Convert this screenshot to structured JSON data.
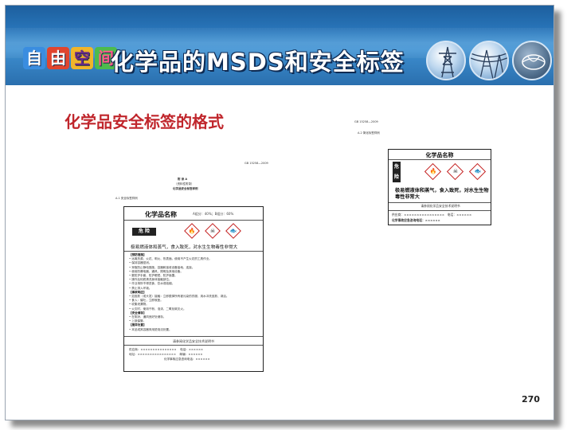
{
  "banner": {
    "logo_chars": [
      "自",
      "由",
      "空",
      "间"
    ],
    "title": "化学品的MSDS和安全标签",
    "photos": [
      "transmission-tower-photo",
      "power-lines-photo",
      "globe-photo"
    ]
  },
  "slide": {
    "heading": "化学品安全标签的格式",
    "page_number": "270"
  },
  "doc_left": {
    "standard_no": "GB 15258—2009",
    "appendix": "附 录 A",
    "appendix_type": "（资料性附录）",
    "appendix_title": "化学品安全标签样例",
    "section": "A.1 安全标签样例",
    "label": {
      "product_name": "化学品名称",
      "components": "A组分：40%；B组分：60%",
      "signal_word": "危 险",
      "pictograms": [
        "flame",
        "skull-crossbones",
        "environment"
      ],
      "hazard_statement": "极易燃液体和蒸气，食入致死，对水生生物毒性非常大",
      "precaution_heading": "【预防措施】",
      "precautions": [
        "• 远离热源、火花、明火、热表面。使用不产生火花的工具作业。",
        "• 保持容器密闭。",
        "• 采取防止静电措施，容器和接收设备接地、连接。",
        "• 使用防爆电器、通风、照明及其他设备。",
        "• 戴防护手套、防护眼镜、防护面罩。",
        "• 操作后彻底清洗身体接触部位。",
        "• 作业场所不得进食、饮水或吸烟。",
        "• 禁止排入环境。"
      ],
      "response_heading": "【事故响应】",
      "responses": [
        "• 如皮肤（或头发）接触：立即脱掉所有被污染的衣服，用水冲洗皮肤、淋浴。",
        "• 食入：催吐，立即就医。",
        "• 收集泄漏物。",
        "• 火灾时，使用干粉、泡沫、二氧化碳灭火。"
      ],
      "storage_heading": "【安全储存】",
      "storage": [
        "• 在阴凉、通风良好处储存。",
        "• 上锁保管。"
      ],
      "disposal_heading": "【废弃处置】",
      "disposal": [
        "• 本品或其容器采用焚烧法处置。"
      ],
      "notice": "请参阅化学品安全技术说明书",
      "supplier": "供应商：×××××××××××××××",
      "address": "地址：××××××××××××××××",
      "postcode": "邮编：××××××",
      "phone": "电话：××××××",
      "emergency": "化学事故应急咨询电话：××××××"
    }
  },
  "doc_right": {
    "standard_no": "GB 15258—2009",
    "section": "A.2 简化标签样例",
    "label": {
      "product_name": "化学品名称",
      "signal_word": "危险",
      "pictograms": [
        "flame",
        "skull-crossbones",
        "environment"
      ],
      "hazard_statement": "极易燃液体和蒸气，食入致死，对水生生物毒性非常大",
      "notice": "请参阅化学品安全技术说明书",
      "supplier": "供应商：××××××××××××××××",
      "phone": "电话：××××××",
      "emergency": "化学事故应急咨询电话：××××××"
    }
  },
  "colors": {
    "banner_blue": "#2a78bd",
    "heading_red": "#c0262c",
    "pictogram_red": "#c41f1f"
  }
}
